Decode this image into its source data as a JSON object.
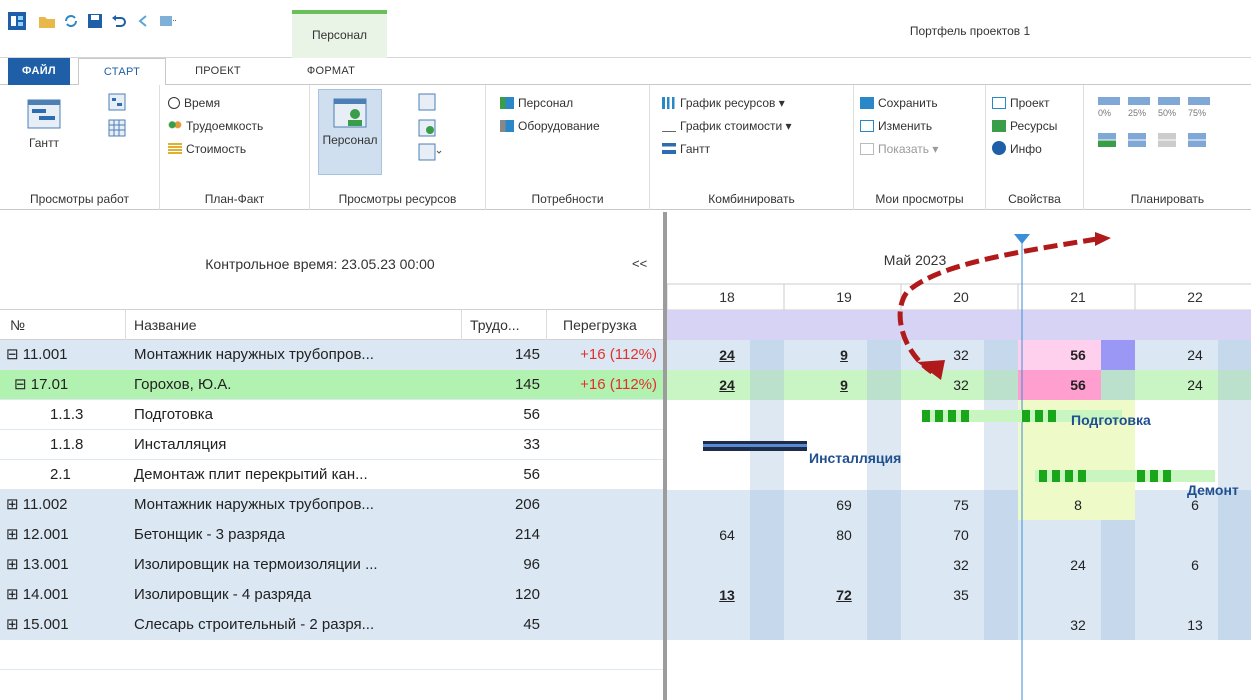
{
  "window_title": "Портфель проектов 1",
  "context_tab": "Персонал",
  "tabs": {
    "file": "ФАЙЛ",
    "start": "СТАРТ",
    "project": "ПРОЕКТ",
    "format": "ФОРМАТ"
  },
  "ribbon": {
    "gantt": "Гантт",
    "work_views_label": "Просмотры работ",
    "time": "Время",
    "labor": "Трудоемкость",
    "cost": "Стоимость",
    "plan_fact_label": "План-Факт",
    "personnel_btn": "Персонал",
    "resource_views_label": "Просмотры ресурсов",
    "personnel_link": "Персонал",
    "equipment": "Оборудование",
    "needs_label": "Потребности",
    "resource_chart": "График ресурсов",
    "cost_chart": "График стоимости",
    "gantt_small": "Гантт",
    "combine_label": "Комбинировать",
    "save": "Сохранить",
    "edit": "Изменить",
    "show": "Показать",
    "my_views_label": "Мои просмотры",
    "project": "Проект",
    "resources": "Ресурсы",
    "info": "Инфо",
    "properties_label": "Свойства",
    "plan_label": "Планировать",
    "percent_ticks": [
      "0%",
      "25%",
      "50%",
      "75%"
    ]
  },
  "control_time": "Контрольное время: 23.05.23 00:00",
  "collapse_btn": "<<",
  "columns": {
    "num": "№",
    "name": "Название",
    "labor": "Трудо...",
    "overload": "Перегрузка"
  },
  "rows": [
    {
      "num": "⊟ 11.001",
      "name": "Монтажник наружных трубопров...",
      "labor": "145",
      "overload": "+16 (112%)"
    },
    {
      "num": "⊟ 17.01",
      "name": "Горохов, Ю.А.",
      "labor": "145",
      "overload": "+16 (112%)"
    },
    {
      "num": "1.1.3",
      "name": "Подготовка",
      "labor": "56",
      "overload": ""
    },
    {
      "num": "1.1.8",
      "name": "Инсталляция",
      "labor": "33",
      "overload": ""
    },
    {
      "num": "2.1",
      "name": "Демонтаж  плит перекрытий кан...",
      "labor": "56",
      "overload": ""
    },
    {
      "num": "⊞ 11.002",
      "name": "Монтажник наружных трубопров...",
      "labor": "206",
      "overload": ""
    },
    {
      "num": "⊞ 12.001",
      "name": "Бетонщик - 3 разряда",
      "labor": "214",
      "overload": ""
    },
    {
      "num": "⊞ 13.001",
      "name": "Изолировщик на термоизоляции ...",
      "labor": "96",
      "overload": ""
    },
    {
      "num": "⊞ 14.001",
      "name": "Изолировщик - 4 разряда",
      "labor": "120",
      "overload": ""
    },
    {
      "num": "⊞ 15.001",
      "name": "Слесарь строительный - 2 разря...",
      "labor": "45",
      "overload": ""
    }
  ],
  "chart": {
    "month": "Май 2023",
    "days": [
      "18",
      "19",
      "20",
      "21",
      "22"
    ],
    "values": [
      [
        "24",
        "9",
        "32",
        "56",
        "24"
      ],
      [
        "24",
        "9",
        "32",
        "56",
        "24"
      ],
      [
        "",
        "",
        "",
        "",
        ""
      ],
      [
        "",
        "",
        "",
        "",
        ""
      ],
      [
        "",
        "",
        "",
        "",
        ""
      ],
      [
        "",
        "69",
        "75",
        "8",
        "6"
      ],
      [
        "64",
        "80",
        "70",
        "",
        ""
      ],
      [
        "",
        "",
        "32",
        "24",
        "6"
      ],
      [
        "13",
        "72",
        "35",
        "",
        ""
      ],
      [
        "",
        "",
        "",
        "32",
        "13"
      ]
    ],
    "task_labels": {
      "prep": "Подготовка",
      "install": "Инсталляция",
      "demont": "Демонт"
    }
  }
}
